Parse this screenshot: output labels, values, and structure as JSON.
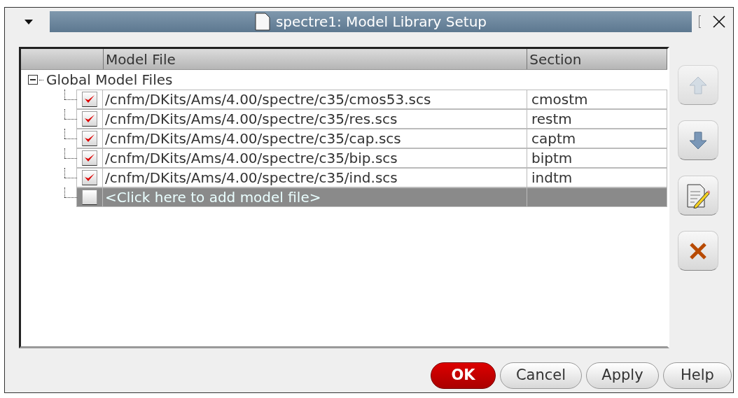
{
  "window": {
    "title": "spectre1: Model Library Setup"
  },
  "table": {
    "columns": [
      "Model File",
      "Section"
    ],
    "root": {
      "label": "Global Model Files",
      "expanded": true,
      "children": [
        {
          "checked": true,
          "file": "/cnfm/DKits/Ams/4.00/spectre/c35/cmos53.scs",
          "section": "cmostm",
          "selected": false
        },
        {
          "checked": true,
          "file": "/cnfm/DKits/Ams/4.00/spectre/c35/res.scs",
          "section": "restm",
          "selected": false
        },
        {
          "checked": true,
          "file": "/cnfm/DKits/Ams/4.00/spectre/c35/cap.scs",
          "section": "captm",
          "selected": false
        },
        {
          "checked": true,
          "file": "/cnfm/DKits/Ams/4.00/spectre/c35/bip.scs",
          "section": "biptm",
          "selected": false
        },
        {
          "checked": true,
          "file": "/cnfm/DKits/Ams/4.00/spectre/c35/ind.scs",
          "section": "indtm",
          "selected": false
        },
        {
          "checked": false,
          "file": "<Click here to add model file>",
          "selected": true
        }
      ]
    }
  },
  "side_buttons": [
    {
      "kind": "up",
      "disabled": true
    },
    {
      "kind": "down",
      "disabled": false
    },
    {
      "kind": "edit",
      "disabled": false
    },
    {
      "kind": "delete",
      "disabled": false
    }
  ],
  "buttons": [
    {
      "label": "OK",
      "primary": true
    },
    {
      "label": "Cancel",
      "primary": false
    },
    {
      "label": "Apply",
      "primary": false
    },
    {
      "label": "Help",
      "primary": false
    }
  ]
}
